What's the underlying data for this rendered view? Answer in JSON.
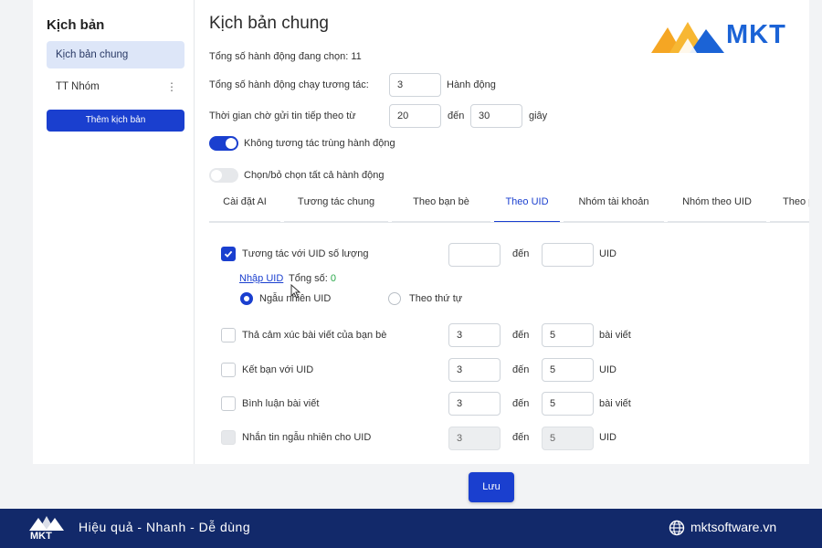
{
  "sidebar": {
    "title": "Kịch bản",
    "items": [
      {
        "label": "Kịch bản chung",
        "active": true
      },
      {
        "label": "TT Nhóm",
        "active": false,
        "menu": "⋮"
      }
    ],
    "add_button": "Thêm kịch bản"
  },
  "header": {
    "title": "Kịch bản chung",
    "logo_text": "MKT"
  },
  "settings": {
    "total_selected": "Tổng số hành động đang chọn: 11",
    "actions_run_label": "Tổng số hành động chạy tương tác:",
    "actions_run_value": "3",
    "actions_run_unit": "Hành động",
    "wait_label": "Thời gian chờ gửi tin tiếp theo từ",
    "wait_from": "20",
    "wait_to_label": "đến",
    "wait_to": "30",
    "wait_unit": "giây",
    "no_duplicate_label": "Không tương tác trùng hành động",
    "no_duplicate_on": true,
    "select_all_label": "Chọn/bỏ chọn tất cả hành động",
    "select_all_on": false
  },
  "tabs": [
    {
      "label": "Cài đặt AI",
      "active": false
    },
    {
      "label": "Tương tác chung",
      "active": false
    },
    {
      "label": "Theo bạn bè",
      "active": false
    },
    {
      "label": "Theo UID",
      "active": true
    },
    {
      "label": "Nhóm tài khoản",
      "active": false
    },
    {
      "label": "Nhóm theo UID",
      "active": false
    },
    {
      "label": "Theo pa",
      "active": false
    }
  ],
  "uid_section": {
    "interact_label": "Tương tác với UID số lượng",
    "interact_checked": true,
    "interact_from": "",
    "to_label": "đến",
    "interact_to": "",
    "interact_unit": "UID",
    "import_link": "Nhập UID",
    "total_label": "Tổng số:",
    "total_value": "0",
    "radio_random": "Ngẫu nhiên UID",
    "radio_order": "Theo thứ tự",
    "radio_selected": "random"
  },
  "rows": [
    {
      "label": "Thả cảm xúc bài viết của bạn bè",
      "from": "3",
      "to_label": "đến",
      "to": "5",
      "unit": "bài viết",
      "checked": false,
      "disabled": false
    },
    {
      "label": "Kết bạn với UID",
      "from": "3",
      "to_label": "đến",
      "to": "5",
      "unit": "UID",
      "checked": false,
      "disabled": false
    },
    {
      "label": "Bình luận bài viết",
      "from": "3",
      "to_label": "đến",
      "to": "5",
      "unit": "bài viết",
      "checked": false,
      "disabled": false
    },
    {
      "label": "Nhắn tin ngẫu nhiên cho UID",
      "from": "3",
      "to_label": "đến",
      "to": "5",
      "unit": "UID",
      "checked": false,
      "disabled": true
    }
  ],
  "save_button": "Lưu",
  "footer": {
    "brand": "MKT",
    "tagline": "Hiệu quả - Nhanh - Dễ dùng",
    "website": "mktsoftware.vn"
  },
  "colors": {
    "primary": "#1a3fcf",
    "footer_bg": "#12296a",
    "logo_blue": "#1b63d6",
    "logo_orange": "#f5a623",
    "success": "#2aa84a"
  }
}
